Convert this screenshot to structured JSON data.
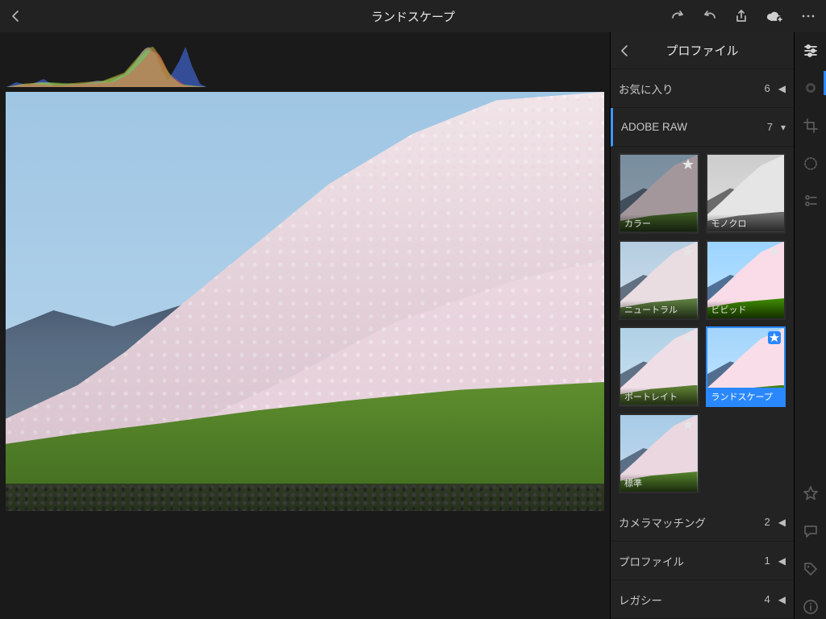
{
  "header": {
    "title": "ランドスケープ"
  },
  "panel": {
    "title": "プロファイル"
  },
  "sections": {
    "favorites": {
      "label": "お気に入り",
      "count": "6"
    },
    "adobe_raw": {
      "label": "ADOBE RAW",
      "count": "7"
    },
    "camera_matching": {
      "label": "カメラマッチング",
      "count": "2"
    },
    "profile": {
      "label": "プロファイル",
      "count": "1"
    },
    "legacy": {
      "label": "レガシー",
      "count": "4"
    }
  },
  "profiles": {
    "color": {
      "label": "カラー",
      "favorite": false,
      "selected": false
    },
    "mono": {
      "label": "モノクロ",
      "favorite": false,
      "selected": false
    },
    "neutral": {
      "label": "ニュートラル",
      "favorite": false,
      "selected": false
    },
    "vivid": {
      "label": "ビビッド",
      "favorite": false,
      "selected": false
    },
    "portrait": {
      "label": "ポートレイト",
      "favorite": false,
      "selected": false
    },
    "landscape": {
      "label": "ランドスケープ",
      "favorite": true,
      "selected": true
    },
    "standard": {
      "label": "標準",
      "favorite": false,
      "selected": false
    }
  }
}
